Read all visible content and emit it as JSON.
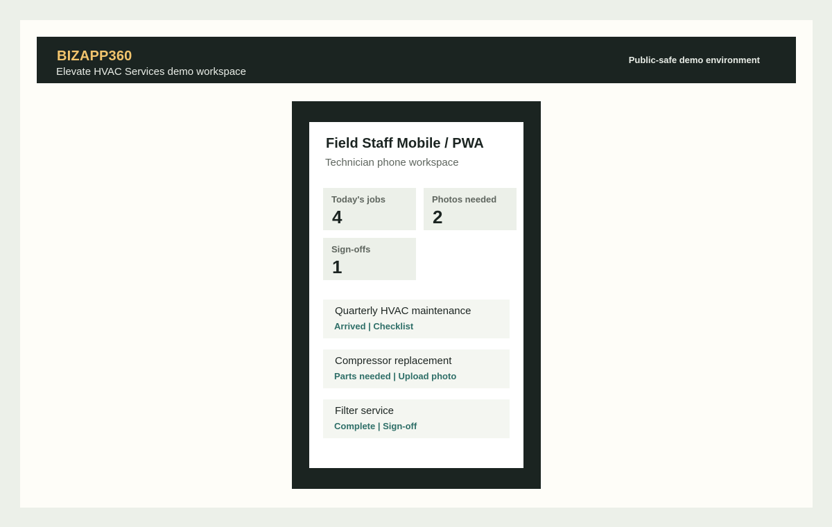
{
  "header": {
    "brand": "BIZAPP360",
    "subtitle": "Elevate HVAC Services demo workspace",
    "environment": "Public-safe demo environment"
  },
  "phone": {
    "title": "Field Staff Mobile / PWA",
    "subtitle": "Technician phone workspace",
    "stats": [
      {
        "label": "Today's jobs",
        "value": "4"
      },
      {
        "label": "Photos needed",
        "value": "2"
      },
      {
        "label": "Sign-offs",
        "value": "1"
      }
    ],
    "jobs": [
      {
        "title": "Quarterly HVAC maintenance",
        "meta": "Arrived | Checklist"
      },
      {
        "title": "Compressor replacement",
        "meta": "Parts needed | Upload photo"
      },
      {
        "title": "Filter service",
        "meta": "Complete | Sign-off"
      }
    ]
  },
  "colors": {
    "page_bg": "#ecf0e9",
    "dark": "#1b2421",
    "brand_accent": "#f2c46d",
    "link_teal": "#2f6f68"
  }
}
